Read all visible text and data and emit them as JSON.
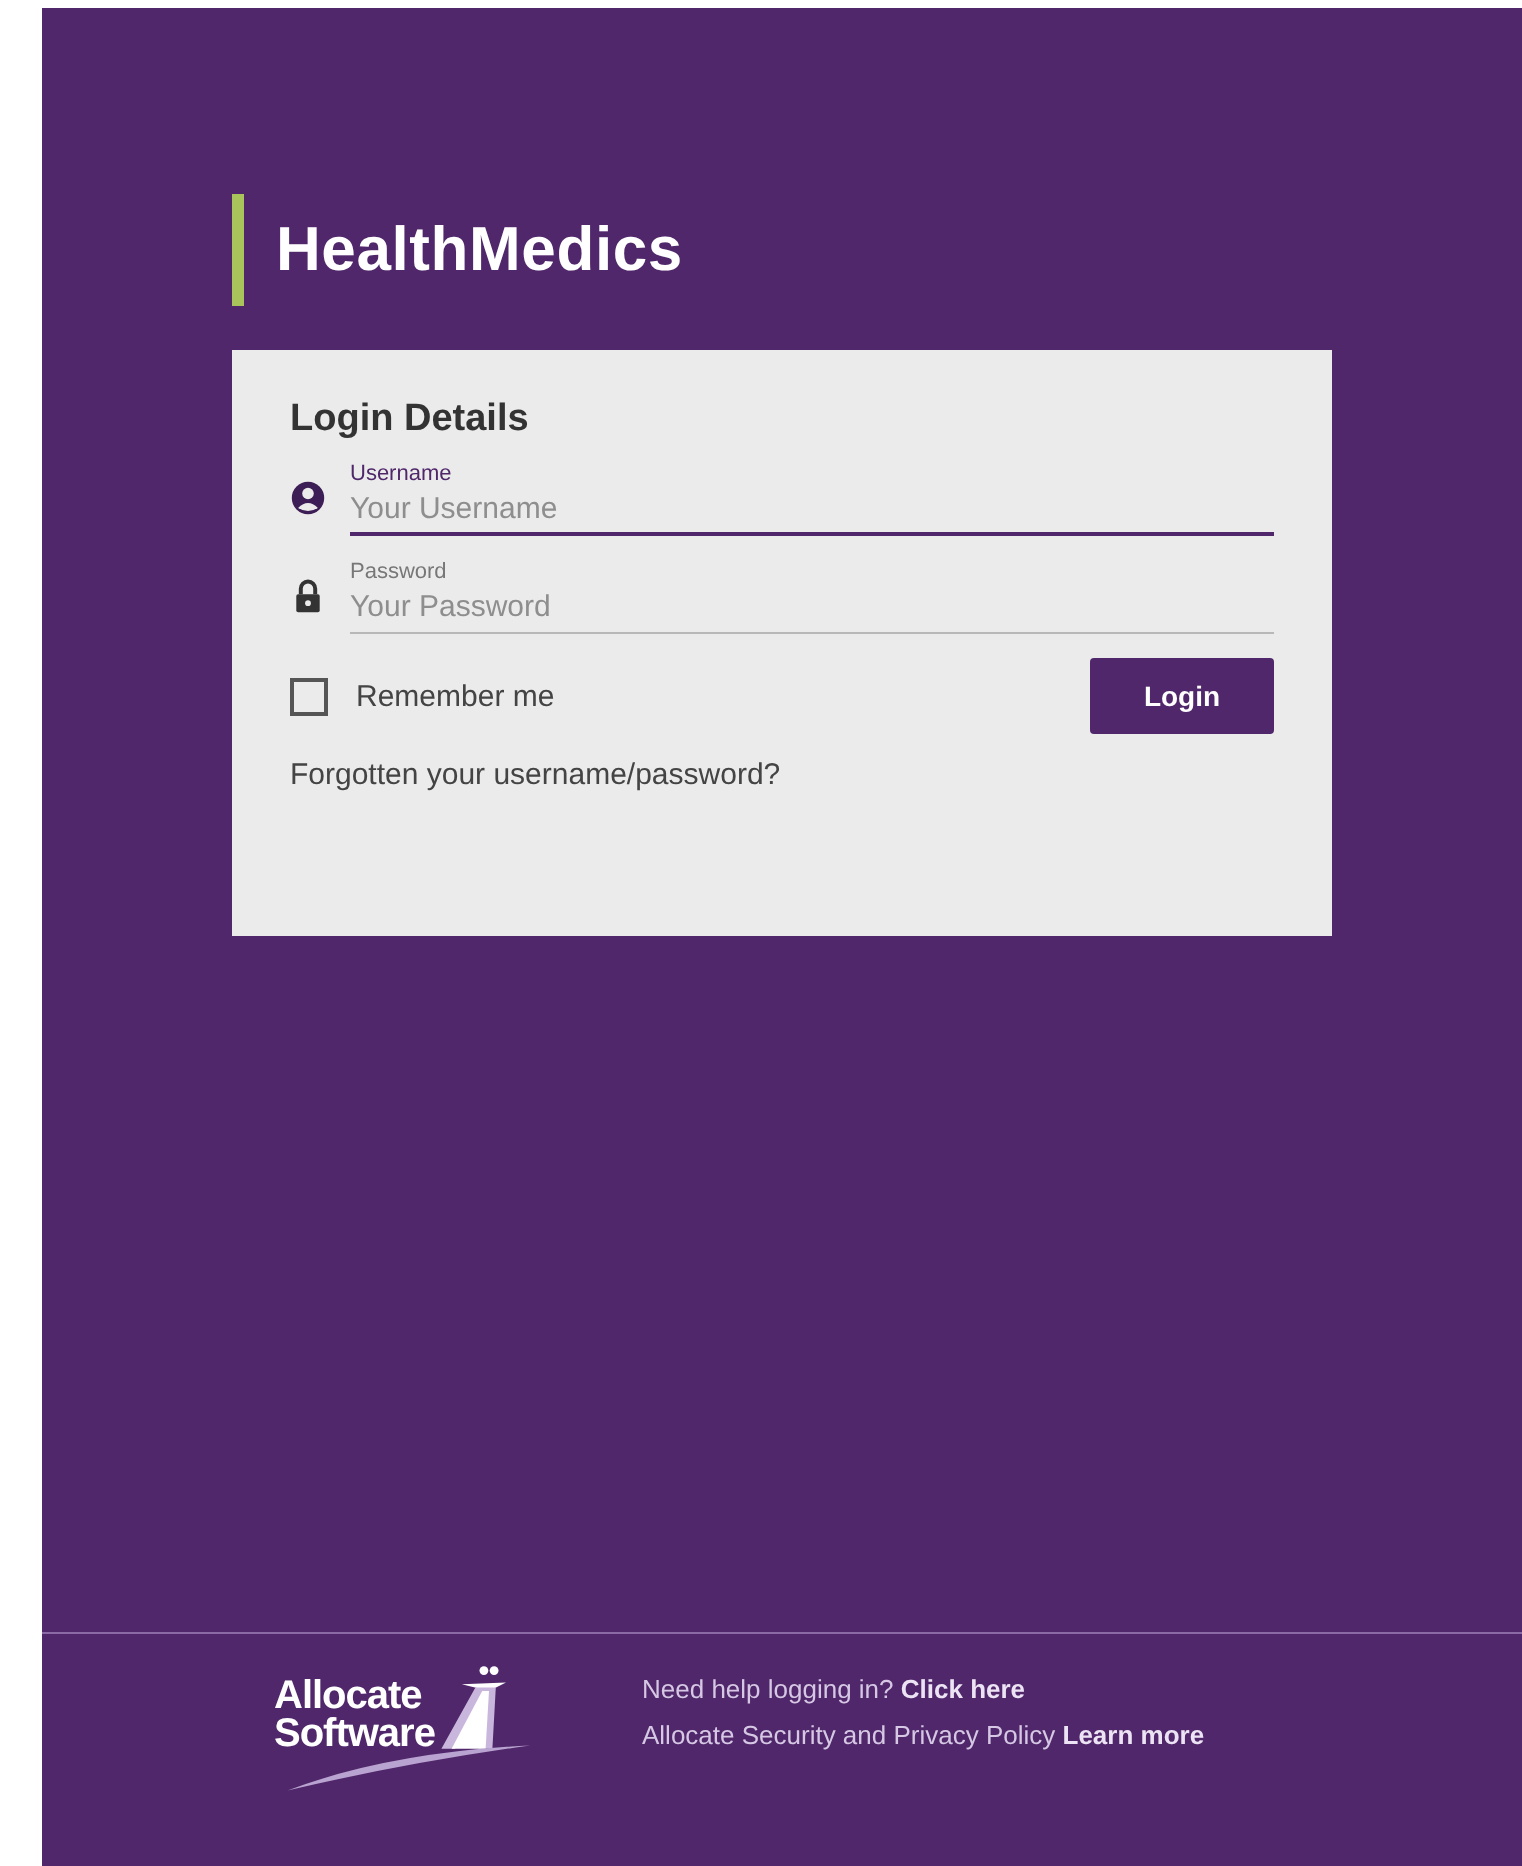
{
  "brand": {
    "name": "HealthMedics"
  },
  "login": {
    "title": "Login Details",
    "fields": [
      {
        "kind": "user",
        "label": "Username",
        "placeholder": "Your Username",
        "focused": true
      },
      {
        "kind": "lock",
        "label": "Password",
        "placeholder": "Your Password",
        "focused": false
      }
    ],
    "remember": {
      "label": "Remember me",
      "checked": false
    },
    "button": "Login",
    "forgot_link": "Forgotten your username/password?"
  },
  "footer": {
    "logo_lines": [
      "Allocate",
      "Software"
    ],
    "lines": [
      {
        "text": "Need help logging in?",
        "link": "Click here"
      },
      {
        "text": "Allocate Security and Privacy Policy",
        "link": "Learn more"
      }
    ]
  }
}
